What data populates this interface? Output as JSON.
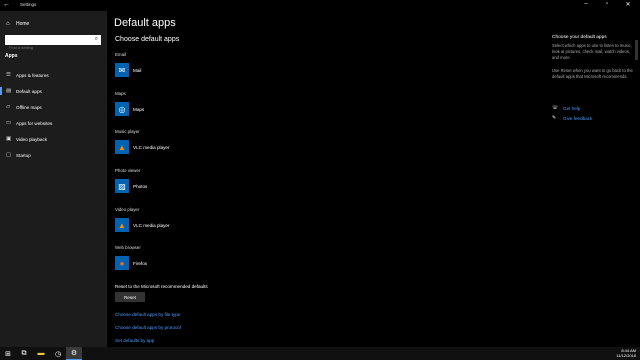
{
  "window": {
    "title": "Settings"
  },
  "sidebar": {
    "home_label": "Home",
    "search_placeholder": "Find a setting",
    "section": "Apps",
    "items": [
      {
        "label": "Apps & features",
        "icon": "list-icon"
      },
      {
        "label": "Default apps",
        "icon": "default-apps-icon"
      },
      {
        "label": "Offline maps",
        "icon": "map-icon"
      },
      {
        "label": "Apps for websites",
        "icon": "web-link-icon"
      },
      {
        "label": "Video playback",
        "icon": "video-icon"
      },
      {
        "label": "Startup",
        "icon": "startup-icon"
      }
    ]
  },
  "main": {
    "title": "Default apps",
    "subtitle": "Choose default apps",
    "categories": [
      {
        "label": "Email",
        "app": "Mail",
        "icon": "mail-icon",
        "color": "#0063b1"
      },
      {
        "label": "Maps",
        "app": "Maps",
        "icon": "maps-icon",
        "color": "#0063b1"
      },
      {
        "label": "Music player",
        "app": "VLC media player",
        "icon": "vlc-icon",
        "color": "#0063b1"
      },
      {
        "label": "Photo viewer",
        "app": "Photos",
        "icon": "photos-icon",
        "color": "#0063b1"
      },
      {
        "label": "Video player",
        "app": "VLC media player",
        "icon": "vlc-icon",
        "color": "#0063b1"
      },
      {
        "label": "Web browser",
        "app": "Firefox",
        "icon": "firefox-icon",
        "color": "#0063b1"
      }
    ],
    "reset_label": "Reset to the Microsoft recommended defaults",
    "reset_button": "Reset",
    "links": [
      "Choose default apps by file type",
      "Choose default apps by protocol",
      "Set defaults by app"
    ]
  },
  "right_panel": {
    "title": "Choose your default apps",
    "para1": "Select which apps to use to listen to music, look at pictures, check mail, watch videos, and more.",
    "para2": "Use Reset when you want to go back to the default apps that Microsoft recommends.",
    "get_help": "Get help",
    "give_feedback": "Give feedback"
  },
  "taskbar": {
    "time": "8:44 AM",
    "date": "11/12/2018"
  },
  "colors": {
    "accent": "#4a9cff",
    "app_tile": "#0063b1",
    "sidebar_bg": "#1c1c1c"
  }
}
